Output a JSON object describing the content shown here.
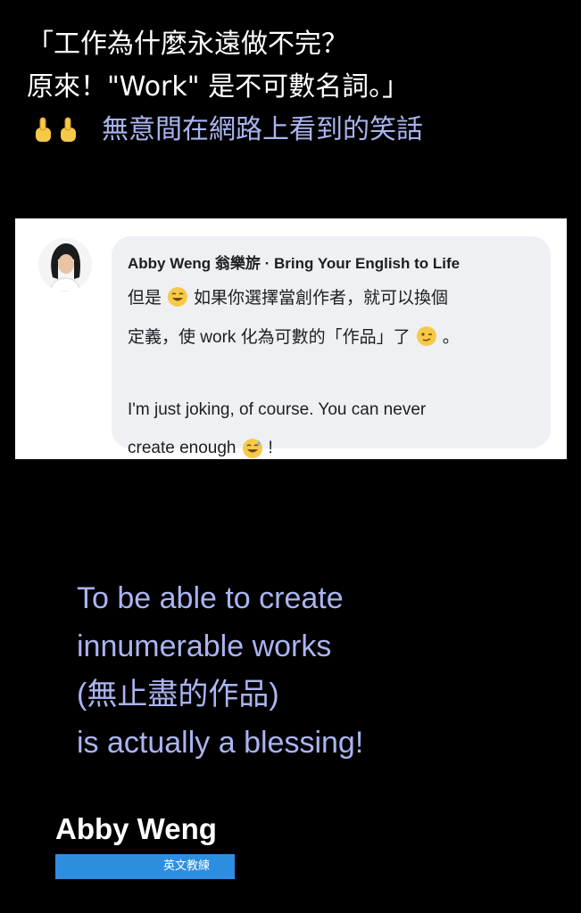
{
  "headline": {
    "line1": "「工作為什麼永遠做不完？",
    "line2": "原來！\"Work\" 是不可數名詞。」",
    "line3": "無意間在網路上看到的笑話",
    "icons": [
      "pointing-up-emoji",
      "pointing-up-emoji"
    ]
  },
  "comment": {
    "author": "Abby Weng 翁樂旂 · Bring Your English to Life",
    "zh_line1_a": "但是",
    "zh_line1_b": "如果你選擇當創作者，就可以換個",
    "zh_line2_a": "定義，使 work 化為可數的「作品」了",
    "zh_line2_b": "。",
    "en_line1": "I'm just joking, of course. You can never",
    "en_line2_a": "create enough",
    "en_line2_b": "!",
    "emojis": [
      "grinning-face",
      "winking-face",
      "grinning-sweat-face"
    ]
  },
  "quote": {
    "line1": "To be able to create",
    "line2": "innumerable works",
    "line3": "(無止盡的作品)",
    "line4": "is actually a blessing!"
  },
  "brand": {
    "name": "Abby Weng",
    "tag": "英文教練"
  },
  "colors": {
    "background": "#000000",
    "accent_text": "#aab4f0",
    "bubble": "#eef0f4",
    "brand_tag": "#2d8ee0",
    "emoji": "#f7c948"
  }
}
